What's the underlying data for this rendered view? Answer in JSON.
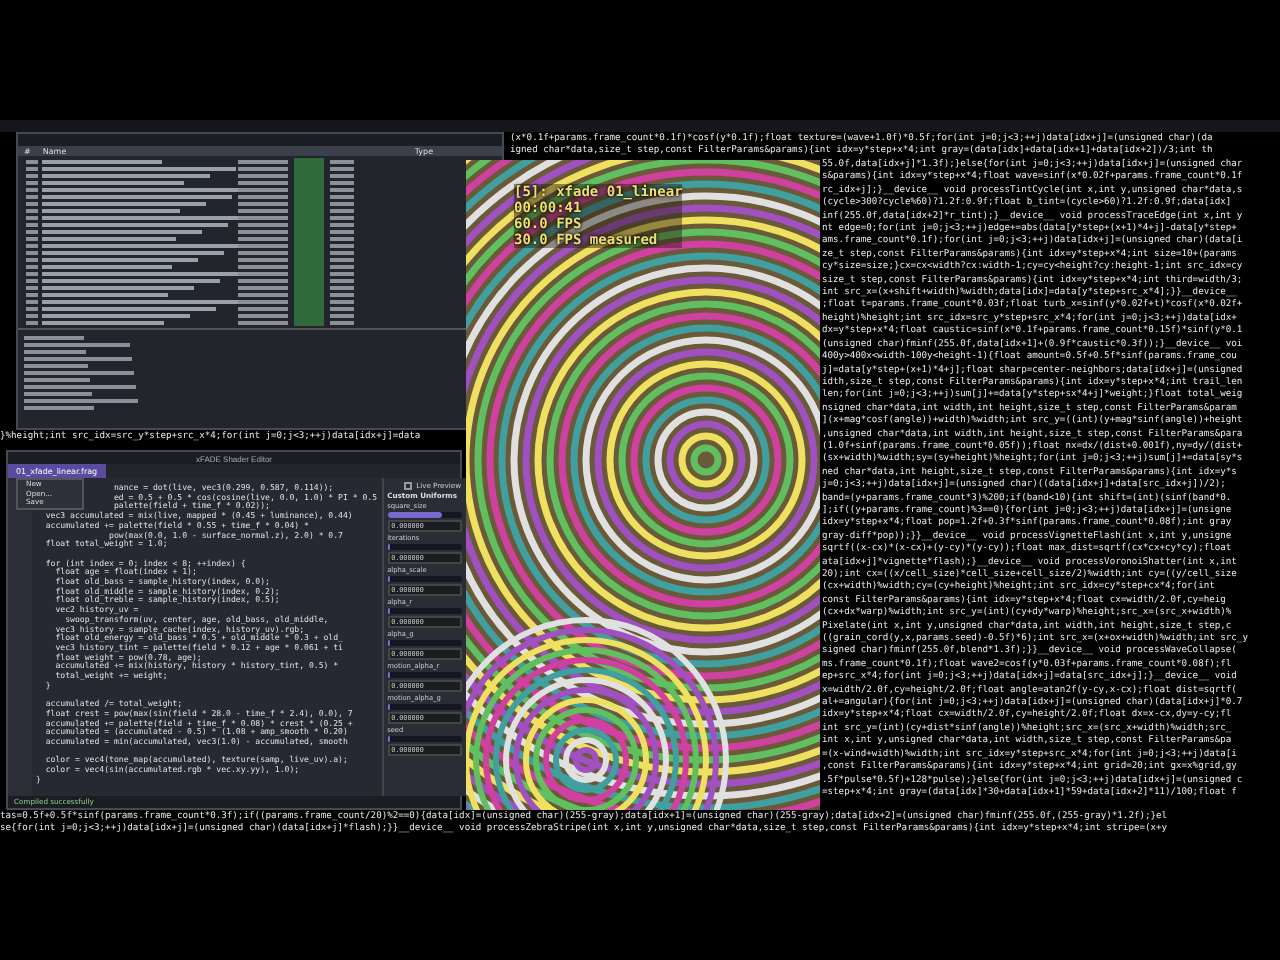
{
  "terminal": {
    "top_lines": [
      "(x*0.1f+params.frame_count*0.1f)*cosf(y*0.1f);float texture=(wave+1.0f)*0.5f;for(int j=0;j<3;++j)data[idx+j]=(unsigned char)(da",
      "igned char*data,size_t step,const FilterParams&params){int idx=y*step+x*4;int gray=(data[idx]+data[idx+1]+data[idx+2])/3;int th"
    ],
    "side_lines": [
      "55.0f,data[idx+j]*1.3f);}else{for(int j=0;j<3;++j)data[idx+j]=(unsigned char",
      "s&params){int idx=y*step+x*4;float wave=sinf(x*0.02f+params.frame_count*0.1f",
      "rc_idx+j];}__device__ void processTintCycle(int x,int y,unsigned char*data,s",
      "(cycle>300?cycle%60)?1.2f:0.9f;float b_tint=(cycle>60)?1.2f:0.9f;data[idx]",
      "inf(255.0f,data[idx+2]*r_tint);}__device__ void processTraceEdge(int x,int y",
      "nt edge=0;for(int j=0;j<3;++j)edge+=abs(data[y*step+(x+1)*4+j]-data[y*step+",
      "ams.frame_count*0.1f);for(int j=0;j<3;++j)data[idx+j]=(unsigned char)(data[i",
      "ze_t step,const FilterParams&params){int idx=y*step+x*4;int size=10+(params",
      "cy*size=size;}cx=cx<width?cx:width-1;cy=cy<height?cy:height-1;int src_idx=cy",
      "size_t step,const FilterParams&params){int idx=y*step+x*4;int third=width/3;",
      "int src_x=(x+shift+width)%width;data[idx]=data[y*step+src_x*4];}}__device__",
      ";float t=params.frame_count*0.03f;float turb_x=sinf(y*0.02f+t)*cosf(x*0.02f+",
      "height)%height;int src_idx=src_y*step+src_x*4;for(int j=0;j<3;++j)data[idx+",
      "dx=y*step+x*4;float caustic=sinf(x*0.1f+params.frame_count*0.15f)*sinf(y*0.1",
      "(unsigned char)fminf(255.0f,data[idx+1]+(0.9f*caustic*0.3f));}__device__ voi",
      "400y>400x<width-100y<height-1){float amount=0.5f+0.5f*sinf(params.frame_cou",
      "j]=data[y*step+(x+1)*4+j];float sharp=center-neighbors;data[idx+j]=(unsigned",
      "idth,size_t step,const FilterParams&params){int idx=y*step+x*4;int trail_len",
      "len;for(int j=0;j<3;++j)sum[j]+=data[y*step+sx*4+j]*weight;}float total_weig",
      "nsigned char*data,int width,int height,size_t step,const FilterParams&param",
      "](x+mag*cosf(angle))+width)%width;int src_y=((int)(y+mag*sinf(angle))+height",
      ",unsigned char*data,int width,int height,size_t step,const FilterParams&para",
      "(1.0f+sinf(params.frame_count*0.05f));float nx=dx/(dist+0.001f),ny=dy/(dist+",
      "(sx+width)%width;sy=(sy+height)%height;for(int j=0;j<3;++j)sum[j]+=data[sy*s",
      "ned char*data,int height,size_t step,const FilterParams&params){int idx=y*s",
      "j=0;j<3;++j)data[idx+j]=(unsigned char)((data[idx+j]+data[src_idx+j])/2);",
      "band=(y+params.frame_count*3)%200;if(band<10){int shift=(int)(sinf(band*0.",
      "];if((y+params.frame_count)%3==0){for(int j=0;j<3;++j)data[idx+j]=(unsigne",
      "idx=y*step+x*4;float pop=1.2f+0.3f*sinf(params.frame_count*0.08f);int gray",
      "gray-diff*pop));}}__device__ void processVignetteFlash(int x,int y,unsigne",
      "sqrtf((x-cx)*(x-cx)+(y-cy)*(y-cy));float max_dist=sqrtf(cx*cx+cy*cy);float",
      "ata[idx+j]*vignette*flash);}__device__ void processVoronoiShatter(int x,int",
      "20);int cx=((x/cell_size)*cell_size+cell_size/2)%width;int cy=((y/cell_size",
      "(cx+width)%width;cy=(cy+height)%height;int src_idx=cy*step+cx*4;for(int",
      "const FilterParams&params){int idx=y*step+x*4;float cx=width/2.0f,cy=heig",
      "(cx+dx*warp)%width;int src_y=(int)(cy+dy*warp)%height;src_x=(src_x+width)%",
      "Pixelate(int x,int y,unsigned char*data,int width,int height,size_t step,c",
      "((grain_cord(y,x,params.seed)-0.5f)*6);int src_x=(x+ox+width)%width;int src_y",
      "signed char)fminf(255.0f,blend*1.3f);}}__device__ void processWaveCollapse(",
      "ms.frame_count*0.1f);float wave2=cosf(y*0.03f+params.frame_count*0.08f);fl",
      "ep+src_x*4;for(int j=0;j<3;++j)data[idx+j]=data[src_idx+j];}__device__ void",
      "x=width/2.0f,cy=height/2.0f;float angle=atan2f(y-cy,x-cx);float dist=sqrtf(",
      "al+=angular){for(int j=0;j<3;++j)data[idx+j]=(unsigned char)(data[idx+j]*0.7",
      "idx=y*step+x*4;float cx=width/2.0f,cy=height/2.0f;float dx=x-cx,dy=y-cy;fl",
      "int src_y=(int)(cy+dist*sinf(angle))%height;src_x=(src_x+width)%width;src_",
      "int x,int y,unsigned char*data,int width,size_t step,const FilterParams&pa",
      "=(x-wind+width)%width;int src_idx=y*step+src_x*4;for(int j=0;j<3;++j)data[i",
      ",const FilterParams&params){int idx=y*step+x*4;int grid=20;int gx=x%grid,gy",
      ".5f*pulse*0.5f)+128*pulse);}else{for(int j=0;j<3;++j)data[idx+j]=(unsigned c",
      "=step+x*4;int gray=(data[idx]*30+data[idx+1]*59+data[idx+2]*11)/100;float f"
    ],
    "middle_line": "}%height;int src_idx=src_y*step+src_x*4;for(int j=0;j<3;++j)data[idx+j]=data",
    "bottom_lines": [
      "tas=0.5f+0.5f*sinf(params.frame_count*0.3f);if((params.frame_count/20)%2==0){data[idx]=(unsigned char)(255-gray);data[idx+1]=(unsigned char)(255-gray);data[idx+2]=(unsigned char)fminf(255.0f,(255-gray)*1.2f);}el",
      "se{for(int j=0;j<3;++j)data[idx+j]=(unsigned char)(data[idx+j]*flash);}}__device__ void processZebraStripe(int x,int y,unsigned char*data,size_t step,const FilterParams&params){int idx=y*step+x*4;int stripe=(x+y"
    ]
  },
  "file_window": {
    "columns": [
      "#",
      "Name",
      "Type"
    ]
  },
  "video": {
    "overlay": [
      "[5]: xfade 01_linear",
      "00:00:41",
      "60.0 FPS",
      "30.0 FPS measured"
    ]
  },
  "editor": {
    "title": "xFADE Shader Editor",
    "tab": "01_xfade_linear.frag",
    "menu": [
      "New",
      "Open...",
      "Save"
    ],
    "live_preview": {
      "label": "Live Preview",
      "checked": false
    },
    "code": [
      [
        "                nance = dot(live, vec3(0.299, 0.587, 0.114));",
        "                ed = 0.5 + 0.5 * cos(cosine(live, 0.0, 1.0) * PI * 0.5",
        "                palette(field + time_f * 0.02));",
        "  vec3 accumulated = mix(live, mapped * (0.45 + luminance), 0.44)",
        "  accumulated += palette(field * 0.55 + time_f * 0.04) *",
        "               pow(max(0.0, 1.0 - surface_normal.z), 2.0) * 0.7",
        "  float total_weight = 1.0;"
      ],
      [
        "  for (int index = 0; index < 8; ++index) {",
        "    float age = float(index + 1);",
        "    float old_bass = sample_history(index, 0.0);",
        "    float old_middle = sample_history(index, 0.2);",
        "    float old_treble = sample_history(index, 0.5);",
        "    vec2 history_uv =",
        "      swoop_transform(uv, center, age, old_bass, old_middle,",
        "    vec3 history = sample_cache(index, history_uv).rgb;",
        "    float old_energy = old_bass * 0.5 + old_middle * 0.3 + old_",
        "    vec3 history_tint = palette(field * 0.12 + age * 0.061 + ti",
        "    float weight = pow(0.78, age);",
        "    accumulated += mix(history, history * history_tint, 0.5) *",
        "    total_weight += weight;",
        "  }"
      ],
      [
        "  accumulated /= total_weight;",
        "  float crest = pow(max(sin(field * 28.0 - time_f * 2.4), 0.0), 7",
        "  accumulated += palette(field + time_f * 0.08) * crest * (0.25 +",
        "  accumulated = (accumulated - 0.5) * (1.08 + amp_smooth * 0.20)",
        "  accumulated = min(accumulated, vec3(1.0) - accumulated, smooth"
      ],
      [
        "  color = vec4(tone_map(accumulated), texture(samp, live_uv).a);",
        "  color = vec4(sin(accumulated.rgb * vec.xy.yy), 1.0);",
        "}"
      ]
    ],
    "uniforms_title": "Custom Uniforms",
    "uniforms": [
      {
        "name": "square_size",
        "level": 0.75,
        "value": "0.000000"
      },
      {
        "name": "iterations",
        "level": 0.05,
        "value": "0.000000"
      },
      {
        "name": "alpha_scale",
        "level": 0.05,
        "value": "0.000000"
      },
      {
        "name": "alpha_r",
        "level": 0.05,
        "value": "0.000000"
      },
      {
        "name": "alpha_g",
        "level": 0.05,
        "value": "0.000000"
      },
      {
        "name": "motion_alpha_r",
        "level": 0.05,
        "value": "0.000000"
      },
      {
        "name": "motion_alpha_g",
        "level": 0.05,
        "value": "0.000000"
      },
      {
        "name": "seed",
        "level": 0.05,
        "value": "0.000000"
      }
    ],
    "status": "Compiled successfully"
  }
}
